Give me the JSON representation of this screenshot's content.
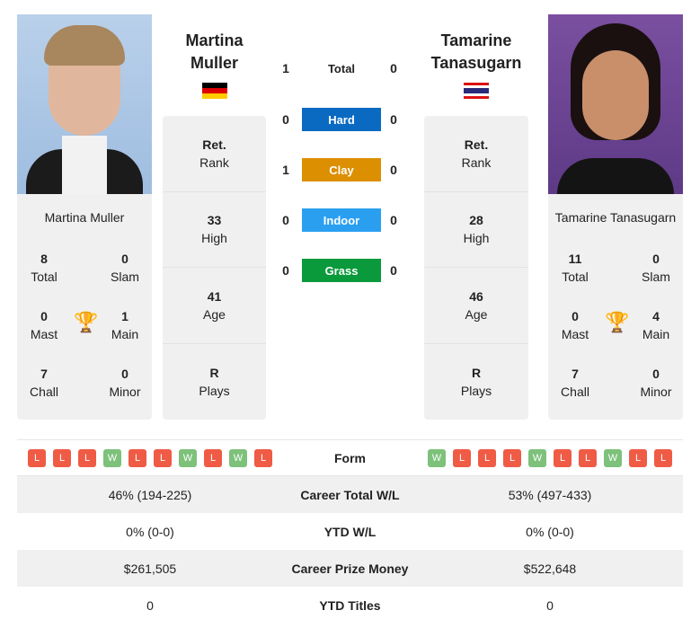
{
  "h2h": {
    "total_label": "Total",
    "total": [
      1,
      0
    ],
    "surfaces": [
      {
        "label": "Hard",
        "left": 0,
        "right": 0,
        "color": "#0a6ac2"
      },
      {
        "label": "Clay",
        "left": 1,
        "right": 0,
        "color": "#dc8f00"
      },
      {
        "label": "Indoor",
        "left": 0,
        "right": 0,
        "color": "#2a9ff0"
      },
      {
        "label": "Grass",
        "left": 0,
        "right": 0,
        "color": "#0a9a3c"
      }
    ]
  },
  "players": [
    {
      "title": [
        "Martina",
        "Muller"
      ],
      "name": "Martina Muller",
      "flag": "germany-flag",
      "total": "8",
      "total_label": "Total",
      "slam": "0",
      "slam_label": "Slam",
      "mast": "0",
      "mast_label": "Mast",
      "main": "1",
      "main_label": "Main",
      "chall": "7",
      "chall_label": "Chall",
      "minor": "0",
      "minor_label": "Minor",
      "rank": [
        "Ret.",
        "Rank"
      ],
      "high": [
        "33",
        "High"
      ],
      "age": [
        "41",
        "Age"
      ],
      "plays": [
        "R",
        "Plays"
      ],
      "form": [
        "L",
        "L",
        "L",
        "W",
        "L",
        "L",
        "W",
        "L",
        "W",
        "L"
      ]
    },
    {
      "title": [
        "Tamarine",
        "Tanasugarn"
      ],
      "name": "Tamarine Tanasugarn",
      "flag": "thailand-flag",
      "total": "11",
      "total_label": "Total",
      "slam": "0",
      "slam_label": "Slam",
      "mast": "0",
      "mast_label": "Mast",
      "main": "4",
      "main_label": "Main",
      "chall": "7",
      "chall_label": "Chall",
      "minor": "0",
      "minor_label": "Minor",
      "rank": [
        "Ret.",
        "Rank"
      ],
      "high": [
        "28",
        "High"
      ],
      "age": [
        "46",
        "Age"
      ],
      "plays": [
        "R",
        "Plays"
      ],
      "form": [
        "W",
        "L",
        "L",
        "L",
        "W",
        "L",
        "L",
        "W",
        "L",
        "L"
      ]
    }
  ],
  "table": {
    "form_label": "Form",
    "rows": [
      {
        "label": "Career Total W/L",
        "a": "46% (194-225)",
        "b": "53% (497-433)"
      },
      {
        "label": "YTD W/L",
        "a": "0% (0-0)",
        "b": "0% (0-0)"
      },
      {
        "label": "Career Prize Money",
        "a": "$261,505",
        "b": "$522,648"
      },
      {
        "label": "YTD Titles",
        "a": "0",
        "b": "0"
      }
    ]
  }
}
